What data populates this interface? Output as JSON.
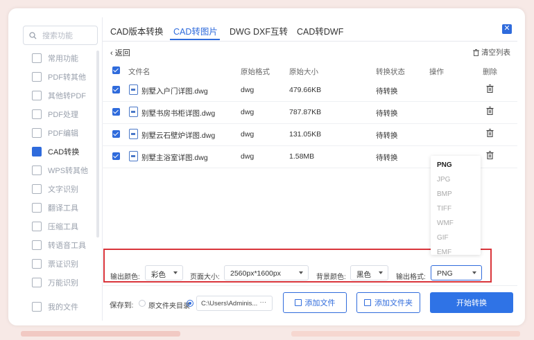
{
  "sidebar": {
    "search_placeholder": "搜索功能",
    "items": [
      {
        "label": "常用功能"
      },
      {
        "label": "PDF转其他"
      },
      {
        "label": "其他转PDF"
      },
      {
        "label": "PDF处理"
      },
      {
        "label": "PDF编辑"
      },
      {
        "label": "CAD转换"
      },
      {
        "label": "WPS转其他"
      },
      {
        "label": "文字识别"
      },
      {
        "label": "翻译工具"
      },
      {
        "label": "压缩工具"
      },
      {
        "label": "转语音工具"
      },
      {
        "label": "票证识别"
      },
      {
        "label": "万能识别"
      },
      {
        "label": "我的文件"
      }
    ],
    "active_index": 5
  },
  "tabs": [
    {
      "label": "CAD版本转换"
    },
    {
      "label": "CAD转图片"
    },
    {
      "label": "DWG DXF互转"
    },
    {
      "label": "CAD转DWF"
    }
  ],
  "active_tab": 1,
  "toolbar": {
    "back": "返回",
    "clear": "清空列表"
  },
  "table": {
    "headers": {
      "name": "文件名",
      "format": "原始格式",
      "size": "原始大小",
      "status": "转换状态",
      "action": "操作",
      "delete": "删除"
    },
    "rows": [
      {
        "name": "别墅入户门详图.dwg",
        "format": "dwg",
        "size": "479.66KB",
        "status": "待转换"
      },
      {
        "name": "别墅书房书柜详图.dwg",
        "format": "dwg",
        "size": "787.87KB",
        "status": "待转换"
      },
      {
        "name": "别墅云石壁炉详图.dwg",
        "format": "dwg",
        "size": "131.05KB",
        "status": "待转换"
      },
      {
        "name": "别墅主浴室详图.dwg",
        "format": "dwg",
        "size": "1.58MB",
        "status": "待转换"
      }
    ]
  },
  "dropdown": {
    "options": [
      "PNG",
      "JPG",
      "BMP",
      "TIFF",
      "WMF",
      "GIF",
      "EMF"
    ],
    "selected": "PNG"
  },
  "settings": {
    "output_color_label": "输出颜色:",
    "output_color_value": "彩色",
    "page_size_label": "页面大小:",
    "page_size_value": "2560px*1600px",
    "bg_color_label": "背景颜色:",
    "bg_color_value": "黑色",
    "output_format_label": "输出格式:",
    "output_format_value": "PNG"
  },
  "footer": {
    "save_to": "保存到:",
    "source_dir": "原文件夹目录",
    "path": "C:\\Users\\Adminis...",
    "path_more": "···",
    "add_file": "添加文件",
    "add_folder": "添加文件夹",
    "start": "开始转换"
  },
  "colors": {
    "accent": "#2f6bdc",
    "highlight_box": "#d9343a"
  }
}
